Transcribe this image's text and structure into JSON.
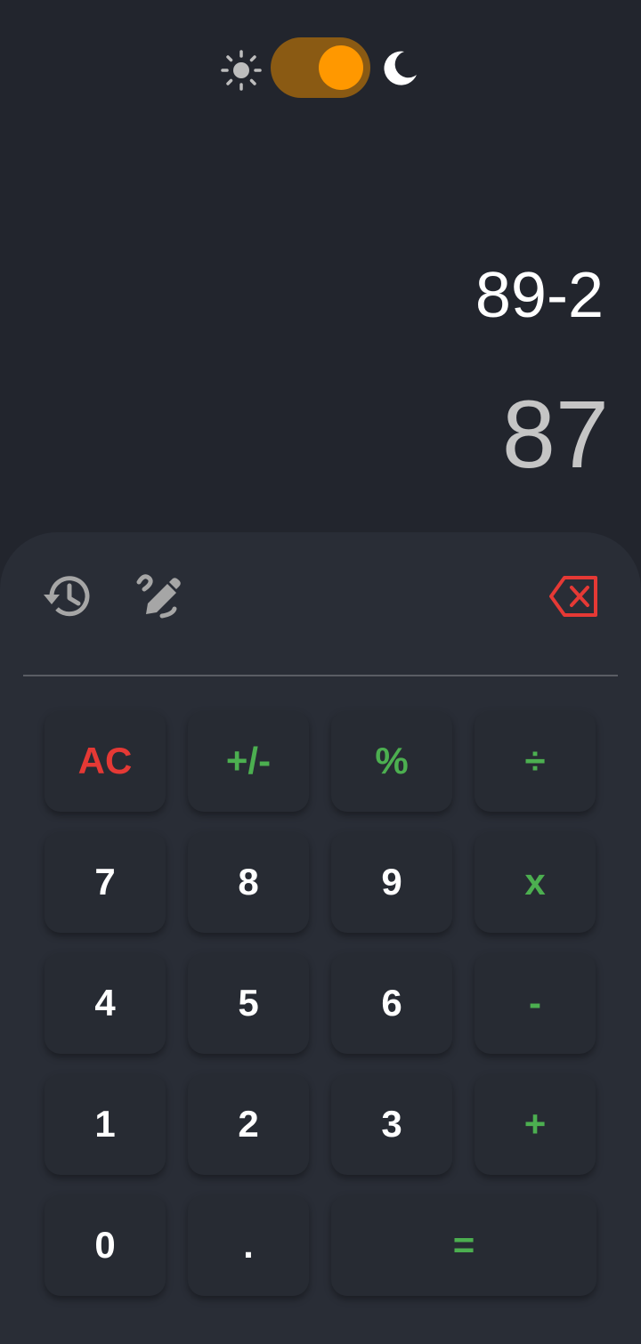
{
  "theme_toggle": {
    "light_icon": "sun-icon",
    "dark_icon": "moon-icon",
    "state": "dark",
    "track_color": "#8a5a13",
    "knob_color": "#ff9800"
  },
  "display": {
    "expression": "89-2",
    "result": "87"
  },
  "toolbar": {
    "history_icon": "history-icon",
    "edit_icon": "edit-icon",
    "backspace_icon": "backspace-icon",
    "backspace_color": "#e53935"
  },
  "keys": {
    "ac": "AC",
    "sign": "+/-",
    "percent": "%",
    "divide": "÷",
    "seven": "7",
    "eight": "8",
    "nine": "9",
    "multiply": "x",
    "four": "4",
    "five": "5",
    "six": "6",
    "minus": "-",
    "one": "1",
    "two": "2",
    "three": "3",
    "plus": "+",
    "zero": "0",
    "dot": ".",
    "equals": "="
  },
  "colors": {
    "background": "#22252d",
    "panel": "#292d36",
    "operator": "#4caf50",
    "clear": "#e53935"
  }
}
